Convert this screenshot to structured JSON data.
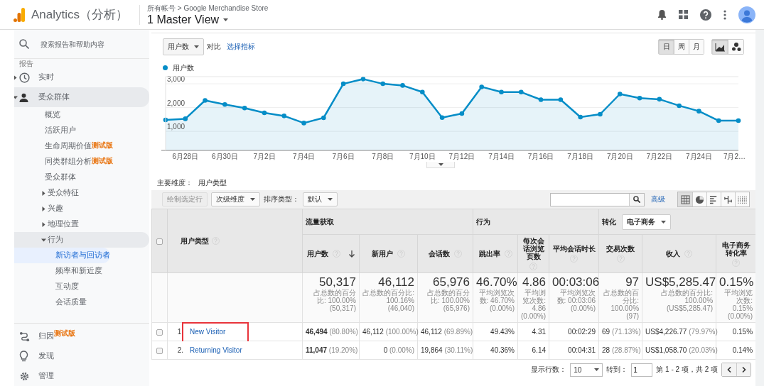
{
  "header": {
    "product": "Analytics（分析）",
    "breadcrumb": "所有帐号 > Google Merchandise Store",
    "view": "1 Master View"
  },
  "sidebar": {
    "search_placeholder": "搜索报告和帮助内容",
    "section": "报告",
    "items": [
      {
        "label": "实时",
        "expanded": false,
        "selected": false
      },
      {
        "label": "受众群体",
        "expanded": true,
        "selected": false,
        "children": [
          {
            "label": "概览",
            "selected": false
          },
          {
            "label": "活跃用户",
            "selected": false
          },
          {
            "label": "生命周期价值",
            "badge": "测试版",
            "selected": false
          },
          {
            "label": "同类群组分析",
            "badge": "测试版",
            "selected": false
          },
          {
            "label": "受众群体",
            "selected": false
          },
          {
            "label": "受众特征",
            "expanded": false,
            "selected": false
          },
          {
            "label": "兴趣",
            "expanded": false,
            "selected": false
          },
          {
            "label": "地理位置",
            "expanded": false,
            "selected": false
          },
          {
            "label": "行为",
            "expanded": true,
            "selected": false,
            "children": [
              {
                "label": "新访者与回访者",
                "selected": true
              },
              {
                "label": "频率和新近度",
                "selected": false
              },
              {
                "label": "互动度",
                "selected": false
              },
              {
                "label": "会话质量",
                "selected": false
              }
            ]
          }
        ]
      }
    ],
    "bottom_items": [
      {
        "label": "归因",
        "badge": "测试版",
        "selected": false
      },
      {
        "label": "发现",
        "selected": false
      },
      {
        "label": "管理",
        "selected": false
      }
    ]
  },
  "controls": {
    "metric": "用户数",
    "compare": "对比",
    "select_metric": "选择指标",
    "granularity": [
      {
        "label": "日",
        "selected": true
      },
      {
        "label": "周",
        "selected": false
      },
      {
        "label": "月",
        "selected": false
      }
    ],
    "chart_types": [
      {
        "kind": "line",
        "selected": true
      },
      {
        "kind": "motion",
        "selected": false
      }
    ]
  },
  "chart_data": {
    "type": "area",
    "grid": true,
    "categories": [
      null,
      "6月28日",
      null,
      "6月30日",
      null,
      "7月2日",
      null,
      "7月4日",
      null,
      "7月6日",
      null,
      "7月8日",
      null,
      "7月10日",
      null,
      "7月12日",
      null,
      "7月14日",
      null,
      "7月16日",
      null,
      "7月18日",
      null,
      "7月20日",
      null,
      "7月22日",
      null,
      "7月24日",
      null,
      "7月2…"
    ],
    "ylim": [
      200,
      3300
    ],
    "series": [
      {
        "name": "用户数",
        "color": "#058dc7",
        "marker": true,
        "values": [
          1480,
          1530,
          2300,
          2130,
          1980,
          1780,
          1650,
          1350,
          1570,
          3000,
          3200,
          3000,
          2930,
          2650,
          1580,
          1750,
          2870,
          2650,
          2650,
          2330,
          2330,
          1600,
          1720,
          2570,
          2400,
          2350,
          2080,
          1850,
          1450,
          1450
        ]
      }
    ],
    "yticks": [
      {
        "value": 1000,
        "label": "1,000"
      },
      {
        "value": 2000,
        "label": "2,000"
      },
      {
        "value": 3000,
        "label": "3,000"
      }
    ]
  },
  "primary_dimension": {
    "label": "主要维度：",
    "value": "用户类型"
  },
  "table_toolbar": {
    "plot_rows": {
      "label": "绘制选定行",
      "disabled": true
    },
    "secondary": "次级维度",
    "sort_label": "排序类型：",
    "sort": "默认",
    "advanced": "高级",
    "views": [
      {
        "kind": "table",
        "selected": true
      },
      {
        "kind": "pie",
        "selected": false
      },
      {
        "kind": "bar",
        "selected": false
      },
      {
        "kind": "compare",
        "selected": false
      },
      {
        "kind": "pivot",
        "selected": false
      }
    ]
  },
  "table": {
    "select_all_checked": false,
    "dimension": {
      "label": "用户类型",
      "help": true
    },
    "highlight_names": true,
    "groups": [
      {
        "label": "流量获取",
        "columns": [
          {
            "label": "用户数",
            "help": true,
            "sorted": true
          },
          {
            "label": "新用户",
            "help": true,
            "sorted": false
          },
          {
            "label": "会话数",
            "help": true,
            "sorted": false
          }
        ]
      },
      {
        "label": "行为",
        "columns": [
          {
            "label": "跳出率",
            "help": true,
            "sorted": false
          },
          {
            "label": "每次会话浏览页数",
            "help": true,
            "sorted": false
          },
          {
            "label": "平均会话时长",
            "help": true,
            "sorted": false
          }
        ]
      },
      {
        "label": "转化",
        "dropdown": "电子商务",
        "columns": [
          {
            "label": "交易次数",
            "help": true,
            "sorted": false
          },
          {
            "label": "收入",
            "help": true,
            "sorted": false
          },
          {
            "label": "电子商务转化率",
            "help": true,
            "sorted": false
          }
        ]
      }
    ],
    "totals": [
      {
        "value": "50,317",
        "sub": "占总数的百分比: 100.00% (50,317)"
      },
      {
        "value": "46,112",
        "sub": "占总数的百分比: 100.16% (46,040)"
      },
      {
        "value": "65,976",
        "sub": "占总数的百分比: 100.00% (65,976)"
      },
      {
        "value": "46.70%",
        "sub": "平均浏览次数: 46.70% (0.00%)"
      },
      {
        "value": "4.86",
        "sub": "平均浏览次数: 4.86 (0.00%)"
      },
      {
        "value": "00:03:06",
        "sub": "平均浏览次数: 00:03:06 (0.00%)"
      },
      {
        "value": "97",
        "sub": "占总数的百分比: 100.00% (97)"
      },
      {
        "value": "US$5,285.47",
        "sub": "占总数的百分比: 100.00% (US$5,285.47)"
      },
      {
        "value": "0.15%",
        "sub": "平均浏览次数: 0.15% (0.00%)"
      }
    ],
    "rows": [
      {
        "checked": false,
        "index": "1.",
        "name": "New Visitor",
        "cells": [
          {
            "value": "46,494",
            "pct": "(80.80%)"
          },
          {
            "value": "46,112",
            "pct": "(100.00%)"
          },
          {
            "value": "46,112",
            "pct": "(69.89%)"
          },
          {
            "value": "49.43%"
          },
          {
            "value": "4.31"
          },
          {
            "value": "00:02:29"
          },
          {
            "value": "69",
            "pct": "(71.13%)"
          },
          {
            "value": "US$4,226.77",
            "pct": "(79.97%)"
          },
          {
            "value": "0.15%"
          }
        ]
      },
      {
        "checked": false,
        "index": "2.",
        "name": "Returning Visitor",
        "cells": [
          {
            "value": "11,047",
            "pct": "(19.20%)"
          },
          {
            "value": "0",
            "pct": "(0.00%)"
          },
          {
            "value": "19,864",
            "pct": "(30.11%)"
          },
          {
            "value": "40.36%"
          },
          {
            "value": "6.14"
          },
          {
            "value": "00:04:31"
          },
          {
            "value": "28",
            "pct": "(28.87%)"
          },
          {
            "value": "US$1,058.70",
            "pct": "(20.03%)"
          },
          {
            "value": "0.14%"
          }
        ]
      }
    ]
  },
  "pagination": {
    "rows_label": "显示行数：",
    "rows": "10",
    "goto_label": "转到：",
    "page": "1",
    "range": "第 1 - 2 项，共 2 项"
  }
}
